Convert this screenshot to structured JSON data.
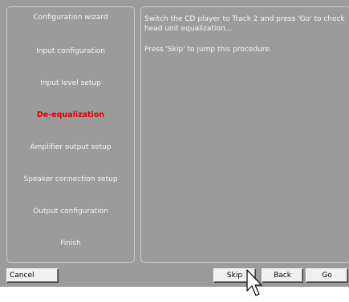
{
  "sidebar": {
    "steps": [
      {
        "label": "Configuration wizard"
      },
      {
        "label": "Input configuration"
      },
      {
        "label": "Input level setup"
      },
      {
        "label": "De-equalization"
      },
      {
        "label": "Amplifier output setup"
      },
      {
        "label": "Speaker connection setup"
      },
      {
        "label": "Output configuration"
      },
      {
        "label": "Finish"
      }
    ],
    "active_step": "De-equalization"
  },
  "content": {
    "instruction": "Switch the CD player to Track 2 and press 'Go' to check head unit equalization...",
    "skip_hint": "Press 'Skip' to jump this procedure."
  },
  "buttons": {
    "cancel": "Cancel",
    "skip": "Skip",
    "back": "Back",
    "go": "Go"
  },
  "colors": {
    "window_background": "#9b9b9b",
    "active_step": "#e10000",
    "step_text": "#f4f4f4",
    "panel_border": "#c8c8c8"
  },
  "icons": {
    "cursor": "mouse-pointer-arrow-icon"
  }
}
